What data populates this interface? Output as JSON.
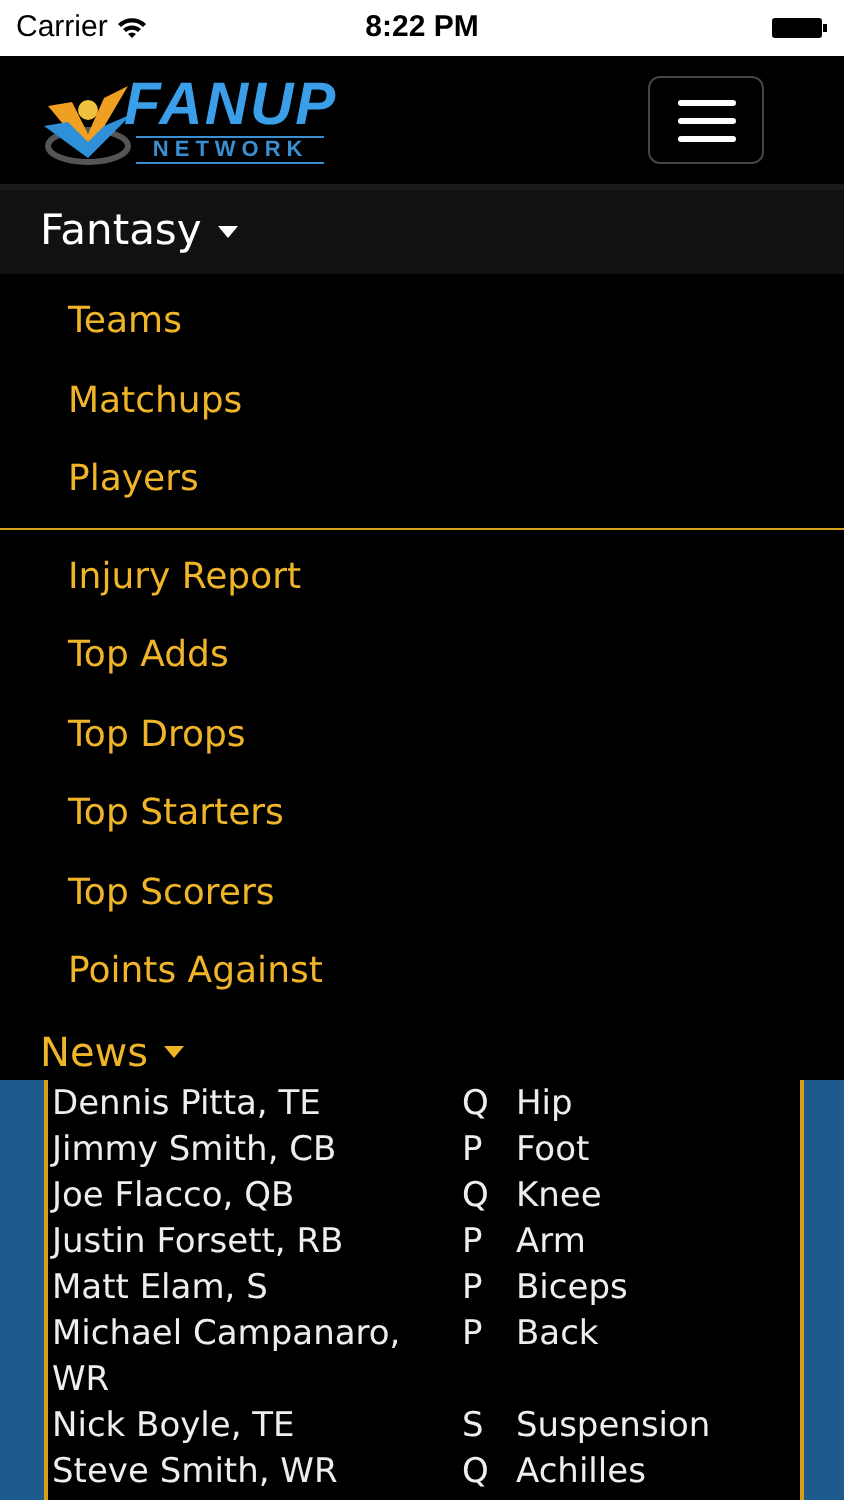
{
  "status_bar": {
    "carrier": "Carrier",
    "time": "8:22 PM"
  },
  "header": {
    "logo": {
      "word": "FANUP",
      "subword": "NETWORK"
    }
  },
  "fantasy_menu": {
    "label": "Fantasy",
    "expanded": true,
    "groups": [
      [
        "Teams",
        "Matchups",
        "Players"
      ],
      [
        "Injury Report",
        "Top Adds",
        "Top Drops",
        "Top Starters",
        "Top Scorers",
        "Points Against"
      ]
    ]
  },
  "news_menu": {
    "label": "News",
    "expanded": false
  },
  "injury_table": {
    "rows": [
      {
        "player": "Dennis Pitta, TE",
        "status": "Q",
        "injury": "Hip"
      },
      {
        "player": "Jimmy Smith, CB",
        "status": "P",
        "injury": "Foot"
      },
      {
        "player": "Joe Flacco, QB",
        "status": "Q",
        "injury": "Knee"
      },
      {
        "player": "Justin Forsett, RB",
        "status": "P",
        "injury": "Arm"
      },
      {
        "player": "Matt Elam, S",
        "status": "P",
        "injury": "Biceps"
      },
      {
        "player": "Michael Campanaro, WR",
        "status": "P",
        "injury": "Back"
      },
      {
        "player": "Nick Boyle, TE",
        "status": "S",
        "injury": "Suspension"
      },
      {
        "player": "Steve Smith, WR",
        "status": "Q",
        "injury": "Achilles"
      }
    ]
  }
}
